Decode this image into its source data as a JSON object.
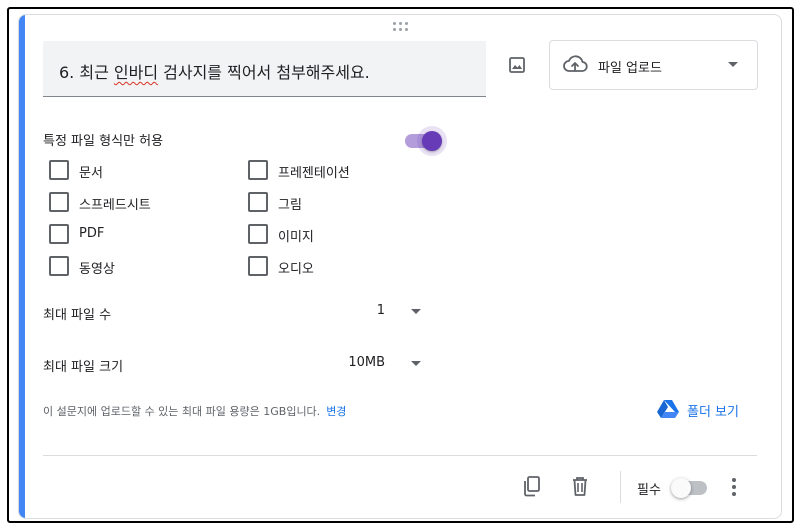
{
  "question": {
    "number_prefix": "6. 최근 ",
    "misspelled_word": "인바디",
    "title_rest": " 검사지를 찍어서 첨부해주세요."
  },
  "question_type": {
    "selected": "파일 업로드",
    "icon": "cloud-upload-icon"
  },
  "allow_specific_types": {
    "label": "특정 파일 형식만 허용",
    "enabled": true
  },
  "file_types": {
    "left": [
      {
        "label": "문서",
        "checked": false
      },
      {
        "label": "스프레드시트",
        "checked": false
      },
      {
        "label": "PDF",
        "checked": false
      },
      {
        "label": "동영상",
        "checked": false
      }
    ],
    "right": [
      {
        "label": "프레젠테이션",
        "checked": false
      },
      {
        "label": "그림",
        "checked": false
      },
      {
        "label": "이미지",
        "checked": false
      },
      {
        "label": "오디오",
        "checked": false
      }
    ]
  },
  "max_files": {
    "label": "최대 파일 수",
    "value": "1"
  },
  "max_size": {
    "label": "최대 파일 크기",
    "value": "10MB"
  },
  "limit_note": {
    "text": "이 설문지에 업로드할 수 있는 최대 파일 용량은 1GB입니다.",
    "link": "변경"
  },
  "folder_link": {
    "label": "폴더 보기",
    "icon": "google-drive-icon"
  },
  "footer": {
    "required_label": "필수",
    "required_enabled": false
  },
  "colors": {
    "accent": "#4285f4",
    "toggle_on": "#673ab7",
    "link": "#1a73e8"
  }
}
